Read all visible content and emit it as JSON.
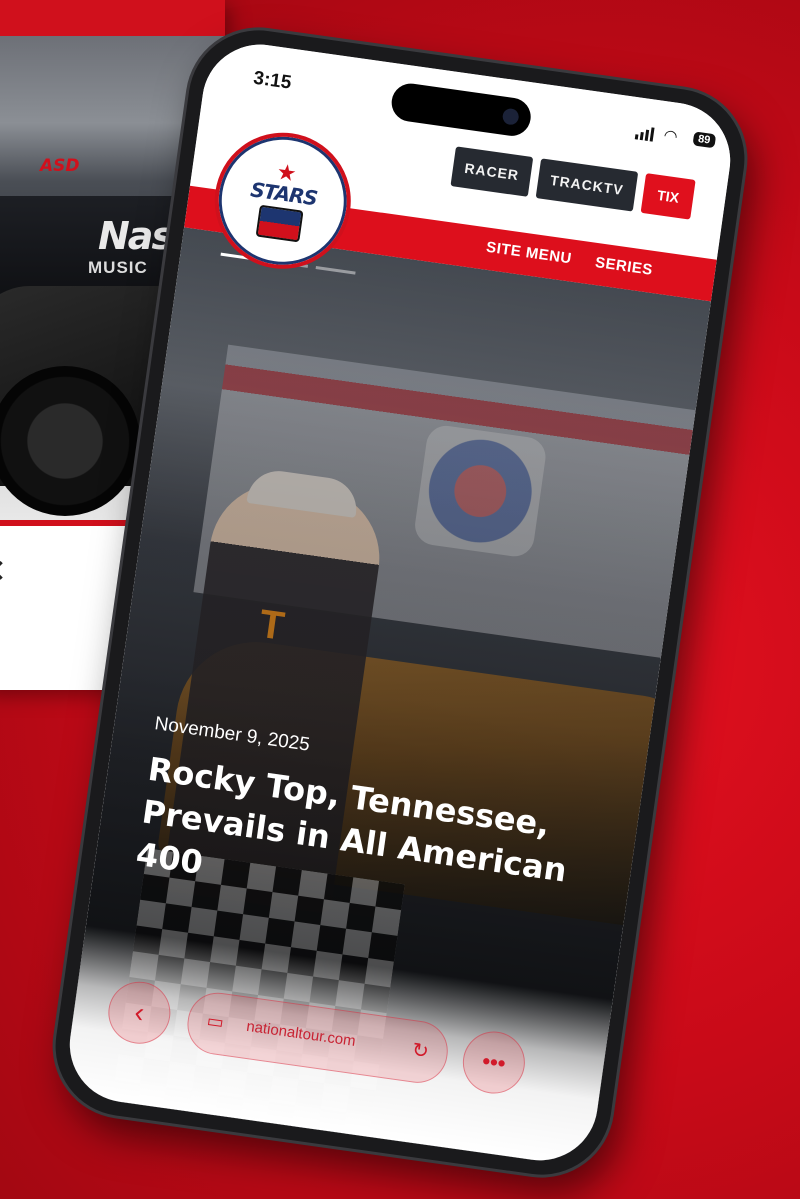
{
  "status_bar": {
    "time": "3:15",
    "battery": "89"
  },
  "header": {
    "racer_label": "RACER",
    "tracktv_label": "TRACKTV",
    "tix_label": "TIX",
    "site_menu_label": "SITE MENU",
    "series_label": "SERIES"
  },
  "logo": {
    "text": "STARS",
    "star": "★"
  },
  "post": {
    "date": "November 9, 2025",
    "title": "Rocky Top, Tennessee, Prevails in All American 400"
  },
  "browser": {
    "url": "nationaltour.com",
    "back_icon": "chevron-left-icon",
    "reload_icon": "reload-icon",
    "more_icon": "more-icon"
  },
  "background_card": {
    "wall_text": "Nash",
    "wall_sub": "MUSIC",
    "sponsor": "ASD"
  },
  "colors": {
    "brand_red": "#dd0f1c",
    "navy": "#1d3570",
    "dark_button": "#262a31"
  }
}
